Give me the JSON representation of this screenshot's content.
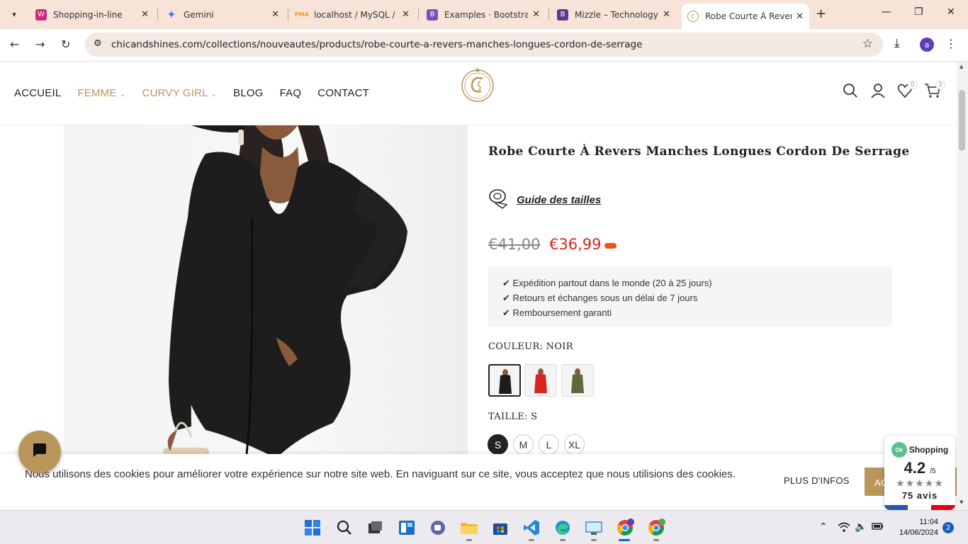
{
  "browser": {
    "tabs": [
      {
        "title": "Shopping-in-line",
        "favicon": "woocommerce-icon",
        "color": "#cc2a78"
      },
      {
        "title": "Gemini",
        "favicon": "gemini-icon",
        "color": "#4a7cf0"
      },
      {
        "title": "localhost / MySQL / c",
        "favicon": "phpmyadmin-icon",
        "color": "#f0a020"
      },
      {
        "title": "Examples · Bootstrap",
        "favicon": "bootstrap-icon",
        "color": "#7952b3"
      },
      {
        "title": "Mizzle – Technology",
        "favicon": "bootstrap-icon",
        "color": "#5b3b8c"
      },
      {
        "title": "Robe Courte À Revers",
        "favicon": "chicandshines-icon",
        "color": "#b9975b"
      }
    ],
    "new_tab_label": "+",
    "url": "chicandshines.com/collections/nouveautes/products/robe-courte-a-revers-manches-longues-cordon-de-serrage",
    "profile_initial": "a"
  },
  "site": {
    "menu": [
      {
        "label": "ACCUEIL",
        "accent": false
      },
      {
        "label": "FEMME",
        "accent": true,
        "dropdown": true
      },
      {
        "label": "CURVY GIRL",
        "accent": true,
        "dropdown": true
      },
      {
        "label": "BLOG",
        "accent": false
      },
      {
        "label": "FAQ",
        "accent": false
      },
      {
        "label": "CONTACT",
        "accent": false
      }
    ],
    "wishlist_count": "0",
    "cart_count": "3",
    "accent_color": "#b9975b"
  },
  "product": {
    "title": "Robe Courte À Revers Manches Longues Cordon De Serrage",
    "size_guide_label": "Guide des tailles",
    "old_price": "€41,00",
    "price": "€36,99",
    "shipping": [
      "✔ Expédition partout dans le monde (20 à 25 jours)",
      "✔ Retours et échanges sous un délai de 7 jours",
      "✔ Remboursement garanti"
    ],
    "color_label": "COULEUR: NOIR",
    "colors": [
      {
        "name": "Noir",
        "hex": "#1c1c1c",
        "selected": true
      },
      {
        "name": "Rouge",
        "hex": "#d8261e",
        "selected": false
      },
      {
        "name": "Vert",
        "hex": "#5e6a3c",
        "selected": false
      }
    ],
    "size_label": "TAILLE: S",
    "sizes": [
      {
        "label": "S",
        "selected": true
      },
      {
        "label": "M",
        "selected": false
      },
      {
        "label": "L",
        "selected": false
      },
      {
        "label": "XL",
        "selected": false
      }
    ]
  },
  "cookie": {
    "text": "Nous utilisons des cookies pour améliorer votre expérience sur notre site web. En naviguant sur ce site, vous acceptez que nous utilisions des cookies.",
    "more_label": "PLUS D'INFOS",
    "accept_label": "AC"
  },
  "review_widget": {
    "brand": "Shopping",
    "score": "4.2",
    "scale": "/5",
    "stars": "★★★★★",
    "count": "75 avis"
  },
  "taskbar": {
    "time": "11:04",
    "date": "14/06/2024",
    "notifications": "2"
  }
}
